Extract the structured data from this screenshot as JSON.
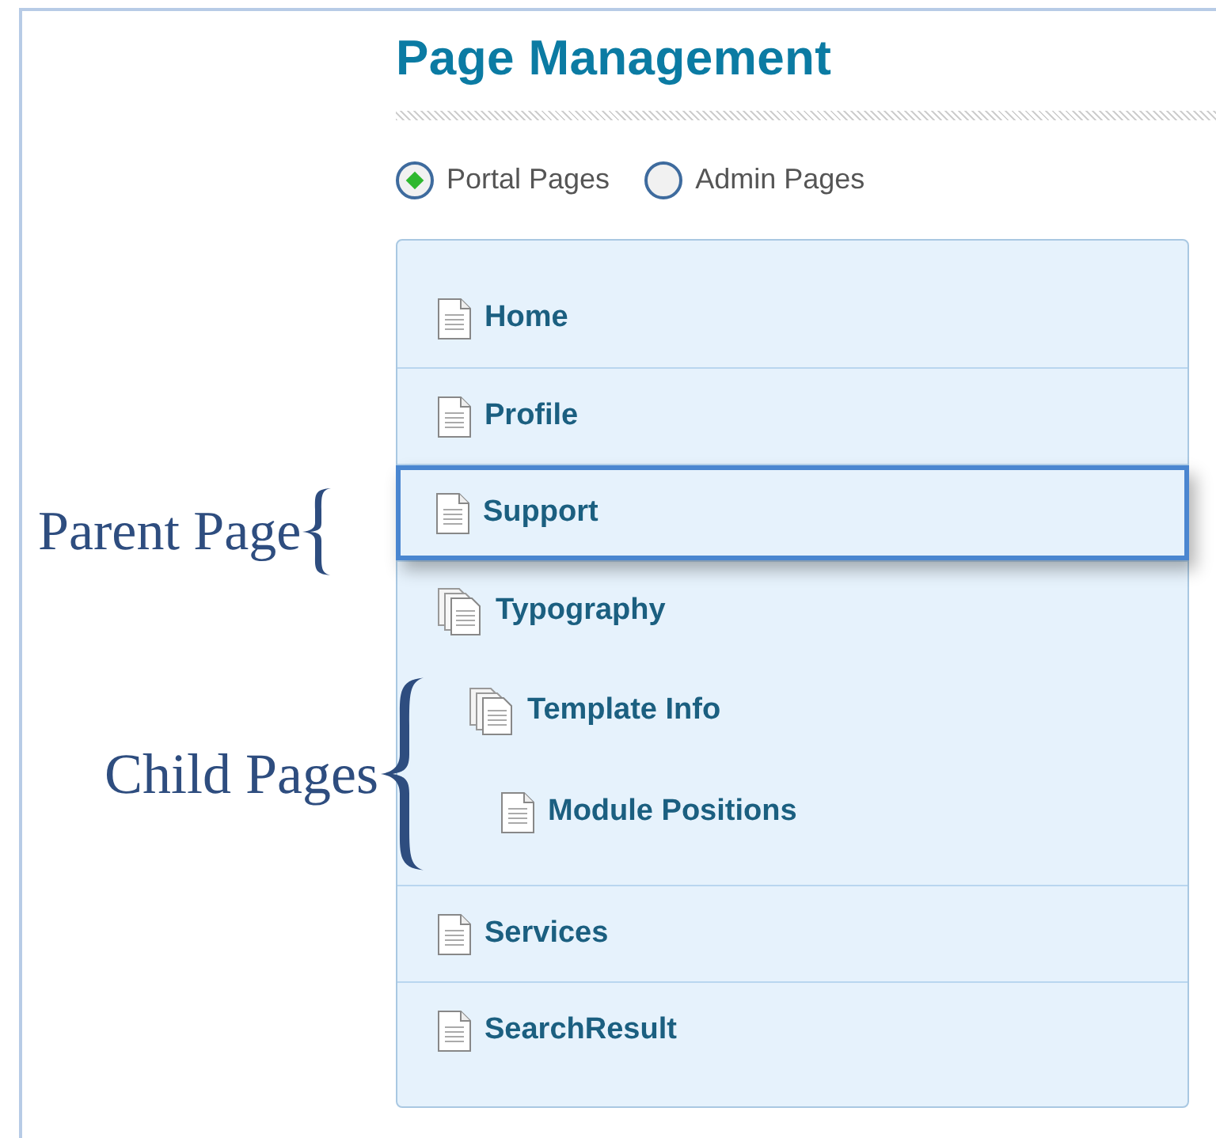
{
  "title": "Page Management",
  "page_types": [
    {
      "label": "Portal Pages",
      "selected": true
    },
    {
      "label": "Admin Pages",
      "selected": false
    }
  ],
  "pages": [
    {
      "label": "Home",
      "selected": false
    },
    {
      "label": "Profile",
      "selected": false
    },
    {
      "label": "Support",
      "selected": true
    },
    {
      "label": "Typography",
      "selected": false,
      "children": [
        {
          "label": "Template Info",
          "selected": false,
          "children": [
            {
              "label": "Module Positions",
              "selected": false
            }
          ]
        }
      ]
    },
    {
      "label": "Services",
      "selected": false
    },
    {
      "label": "SearchResult",
      "selected": false
    }
  ],
  "annotations": [
    {
      "label": "Parent Page",
      "kind": "small"
    },
    {
      "label": "Child Pages",
      "kind": "large"
    }
  ]
}
